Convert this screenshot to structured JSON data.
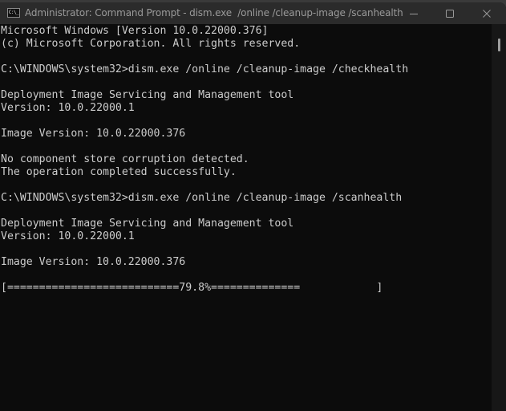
{
  "window": {
    "title": "Administrator: Command Prompt - dism.exe  /online /cleanup-image /scanhealth",
    "app_icon_text": "C:\\_",
    "controls": {
      "minimize": "minimize",
      "maximize": "maximize",
      "close": "close"
    }
  },
  "colors": {
    "console_bg": "#0c0c0c",
    "console_text": "#cccccc",
    "titlebar_bg": "#2b2b2b",
    "title_text": "#9a9a9a"
  },
  "console": {
    "lines": [
      "Microsoft Windows [Version 10.0.22000.376]",
      "(c) Microsoft Corporation. All rights reserved.",
      "",
      "C:\\WINDOWS\\system32>dism.exe /online /cleanup-image /checkhealth",
      "",
      "Deployment Image Servicing and Management tool",
      "Version: 10.0.22000.1",
      "",
      "Image Version: 10.0.22000.376",
      "",
      "No component store corruption detected.",
      "The operation completed successfully.",
      "",
      "C:\\WINDOWS\\system32>dism.exe /online /cleanup-image /scanhealth",
      "",
      "Deployment Image Servicing and Management tool",
      "Version: 10.0.22000.1",
      "",
      "Image Version: 10.0.22000.376",
      "",
      "[===========================79.8%==============            ]"
    ],
    "progress_percent": 79.8
  }
}
